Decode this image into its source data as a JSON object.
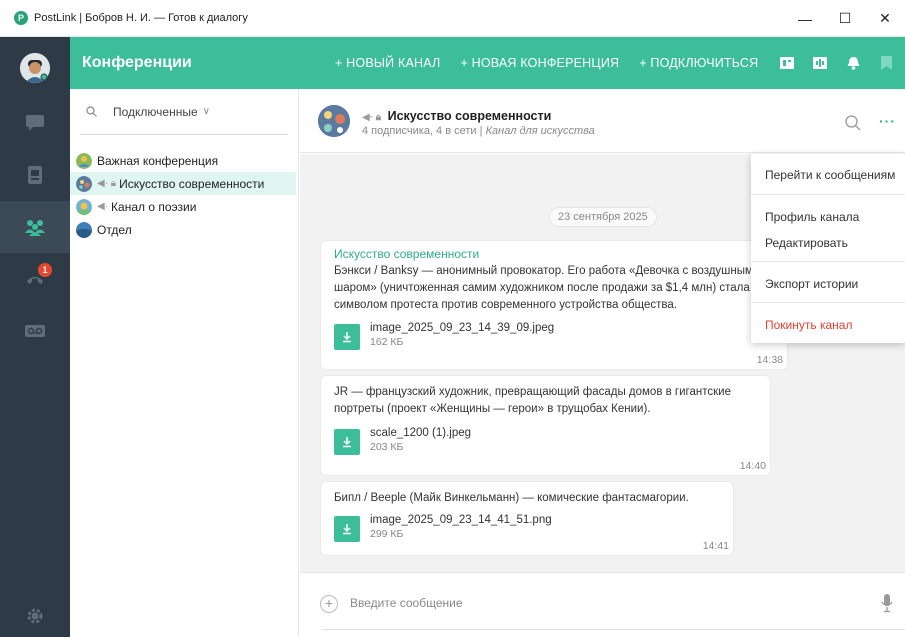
{
  "window": {
    "title": "PostLink  |  Бобров Н. И.  —  Готов к диалогу",
    "app_icon_letter": "P",
    "minimize": "—",
    "maximize": "☐",
    "close": "✕"
  },
  "rail": {
    "badge_count": "1"
  },
  "header": {
    "section_title": "Конференции",
    "actions": [
      "+ НОВЫЙ КАНАЛ",
      "+ НОВАЯ КОНФЕРЕНЦИЯ",
      "+ ПОДКЛЮЧИТЬСЯ"
    ]
  },
  "list": {
    "filter_label": "Подключенные",
    "items": [
      {
        "name": "Важная конференция"
      },
      {
        "name": "Искусство современности"
      },
      {
        "name": "Канал о поэзии"
      },
      {
        "name": "Отдел"
      }
    ]
  },
  "channel": {
    "name": "Искусство современности",
    "subscribers": "4 подписчика, 4 в сети",
    "separator": "|",
    "description": "Канал для искусства"
  },
  "messages": {
    "date": "23 сентября 2025",
    "items": [
      {
        "author": "Искусство современности",
        "text_lines": [
          "Бэнкси / Banksy — анонимный провокатор. Его работа «Девочка с воздушным",
          "шаром» (уничтоженная самим художником после продажи за $1,4 млн) стала",
          "символом протеста против современного устройства общества."
        ],
        "file_name": "image_2025_09_23_14_39_09.jpeg",
        "file_size": "162 КБ",
        "time": "14:38"
      },
      {
        "author": "",
        "text_lines": [
          "JR — французский художник, превращающий фасады домов в гигантские",
          "портреты (проект «Женщины — герои» в трущобах Кении)."
        ],
        "file_name": "scale_1200 (1).jpeg",
        "file_size": "203 КБ",
        "time": "14:40"
      },
      {
        "author": "",
        "text_lines": [
          "Бипл / Beeple (Майк Винкельманн) — комические фантасмагории."
        ],
        "file_name": "image_2025_09_23_14_41_51.png",
        "file_size": "299 КБ",
        "time": "14:41"
      }
    ]
  },
  "composer": {
    "placeholder": "Введите сообщение"
  },
  "menu": {
    "items": [
      "Перейти к сообщениям",
      "Профиль канала",
      "Редактировать",
      "Экспорт истории",
      "Покинуть канал"
    ]
  },
  "colors": {
    "accent": "#3cbe9b",
    "rail": "#2e3b46",
    "danger": "#e0412f"
  }
}
